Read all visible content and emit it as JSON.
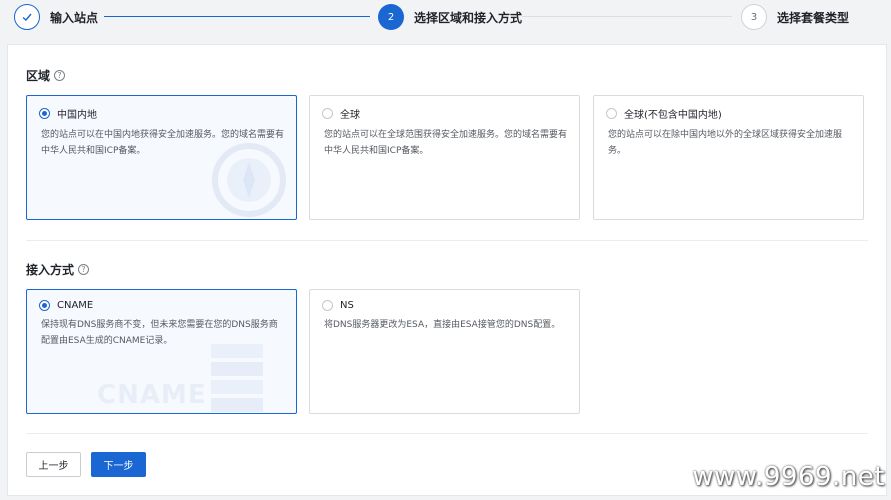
{
  "stepper": {
    "steps": [
      {
        "index": "",
        "label": "输入站点",
        "state": "done"
      },
      {
        "index": "2",
        "label": "选择区域和接入方式",
        "state": "active"
      },
      {
        "index": "3",
        "label": "选择套餐类型",
        "state": "todo"
      }
    ]
  },
  "region": {
    "title": "区域",
    "help": "?",
    "options": [
      {
        "label": "中国内地",
        "desc": "您的站点可以在中国内地获得安全加速服务。您的域名需要有中华人民共和国ICP备案。",
        "selected": true
      },
      {
        "label": "全球",
        "desc": "您的站点可以在全球范围获得安全加速服务。您的域名需要有中华人民共和国ICP备案。",
        "selected": false
      },
      {
        "label": "全球(不包含中国内地)",
        "desc": "您的站点可以在除中国内地以外的全球区域获得安全加速服务。",
        "selected": false
      }
    ]
  },
  "access": {
    "title": "接入方式",
    "help": "?",
    "options": [
      {
        "label": "CNAME",
        "desc": "保持现有DNS服务商不变，但未来您需要在您的DNS服务商配置由ESA生成的CNAME记录。",
        "selected": true,
        "watermark": "CNAME"
      },
      {
        "label": "NS",
        "desc": "将DNS服务器更改为ESA，直接由ESA接管您的DNS配置。",
        "selected": false
      }
    ]
  },
  "buttons": {
    "prev": "上一步",
    "next": "下一步"
  },
  "watermark": "www.9969.net",
  "colors": {
    "accent": "#1a66d2"
  }
}
